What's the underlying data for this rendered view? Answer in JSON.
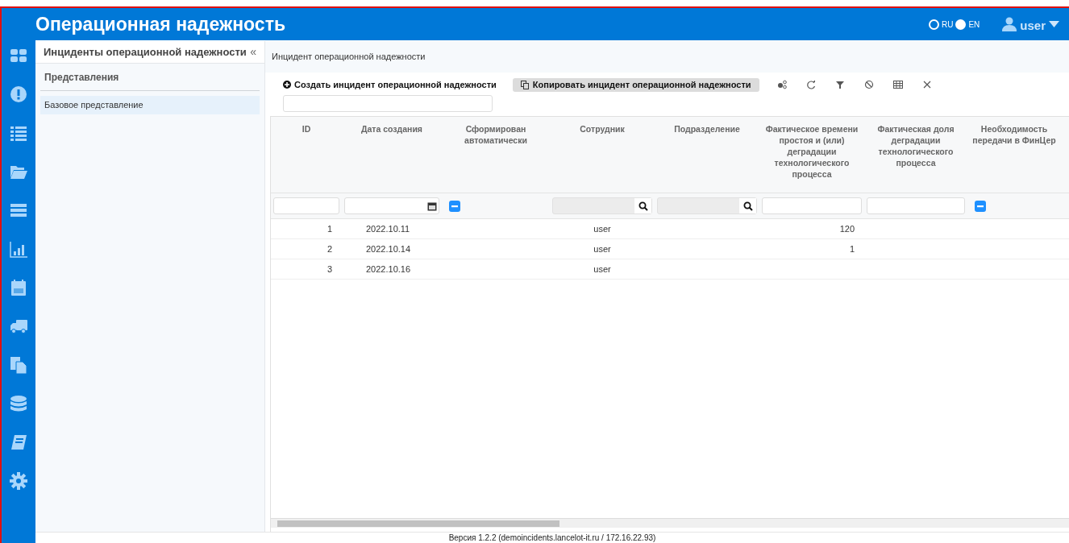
{
  "header": {
    "title": "Операционная надежность",
    "languages": [
      {
        "label": "RU",
        "selected": true
      },
      {
        "label": "EN",
        "selected": false
      }
    ],
    "user": "user"
  },
  "side_panel": {
    "title": "Инциденты операционной надежности",
    "collapse": "«",
    "section": "Представления",
    "items": [
      {
        "label": "Базовое представление",
        "selected": true
      }
    ]
  },
  "main": {
    "title": "Инцидент операционной надежности",
    "create_button": "Создать инцидент операционной надежности",
    "copy_button": "Копировать инцидент операционной надежности"
  },
  "table": {
    "columns": [
      {
        "label": "ID",
        "kind": "text"
      },
      {
        "label": "Дата создания",
        "kind": "date"
      },
      {
        "label": "Сформирован автоматически",
        "kind": "tristate",
        "indeterminate": true
      },
      {
        "label": "Сотрудник",
        "kind": "lookup"
      },
      {
        "label": "Подразделение",
        "kind": "lookup"
      },
      {
        "label": "Фактическое времени простоя и (или) деградации технологического процесса",
        "kind": "text"
      },
      {
        "label": "Фактическая доля деградации технологического процесса",
        "kind": "text"
      },
      {
        "label": "Необходимость передачи в ФинЦер",
        "kind": "tristate",
        "indeterminate": true
      }
    ],
    "rows": [
      [
        "1",
        "2022.10.11",
        "",
        "user",
        "",
        "120",
        "",
        ""
      ],
      [
        "2",
        "2022.10.14",
        "",
        "user",
        "",
        "1",
        "",
        ""
      ],
      [
        "3",
        "2022.10.16",
        "",
        "user",
        "",
        "",
        "",
        ""
      ]
    ]
  },
  "footer": "Версия 1.2.2 (demoincidents.lancelot-it.ru / 172.16.22.93)"
}
